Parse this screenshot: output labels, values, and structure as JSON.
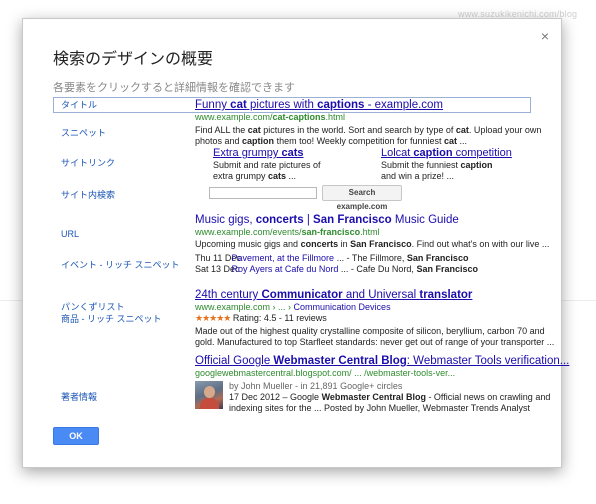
{
  "background": {
    "url": "www.suzukikenichi.com/blog"
  },
  "dialog": {
    "title": "検索のデザインの概要",
    "subtitle": "各要素をクリックすると詳細情報を確認できます",
    "close_label": "×",
    "ok_label": "OK"
  },
  "labels": [
    "タイトル",
    "スニペット",
    "サイトリンク",
    "サイト内検索",
    "URL",
    "イベント - リッチ スニペット",
    "パンくずリスト",
    "商品 - リッチ スニペット",
    "著者情報"
  ],
  "result1": {
    "title_a": "Funny ",
    "title_b": "cat",
    "title_c": " pictures with ",
    "title_d": "captions",
    "title_e": " - example.com",
    "url_a": "www.example.com/",
    "url_b": "cat-captions",
    "url_c": ".html",
    "snip": [
      "Find ALL the ",
      "cat",
      " pictures in the world. Sort and search by type of ",
      "cat",
      ". Upload your own",
      "photos and ",
      "caption",
      " them too! Weekly competition for funniest ",
      "cat",
      " ..."
    ]
  },
  "sitelinks": [
    {
      "t1": "Extra grumpy ",
      "t2": "cats",
      "d1": "Submit and rate pictures of",
      "d2a": "extra grumpy ",
      "d2b": "cats",
      "d2c": " ..."
    },
    {
      "t1": "Lolcat ",
      "t2": "caption",
      "t3": " competition",
      "d1a": "Submit the funniest ",
      "d1b": "caption",
      "d2": "and win a prize! ..."
    }
  ],
  "search": {
    "button_label": "Search example.com"
  },
  "result2": {
    "title_a": "Music gigs, ",
    "title_b": "concerts",
    "title_c": " | ",
    "title_d": "San Francisco",
    "title_e": " Music Guide",
    "url_a": "www.example.com/events/",
    "url_b": "san-francisco",
    "url_c": ".html",
    "snip_a": "Upcoming music gigs and ",
    "snip_b": "concerts",
    "snip_c": " in ",
    "snip_d": "San Francisco",
    "snip_e": ". Find out what's on with our live ...",
    "events": [
      {
        "date": "Thu 11 Dec",
        "link": "Pavement, at the Fillmore",
        "rest_a": " ... - The Fillmore, ",
        "rest_b": "San Francisco"
      },
      {
        "date": "Sat 13 Dec",
        "link": "Roy Ayers at Cafe du Nord",
        "rest_a": " ... - Cafe Du Nord, ",
        "rest_b": "San Francisco"
      }
    ]
  },
  "result3": {
    "title_a": "24th century ",
    "title_b": "Communicator",
    "title_c": " and Universal ",
    "title_d": "translator",
    "crumb_a": "www.example.com › ... › ",
    "crumb_link": "Communication Devices",
    "stars": "★★★★★",
    "rating_text": " Rating: 4.5 - 11 reviews",
    "snip_line1": "Made out of the highest quality crystalline composite of silicon, beryllium, carbon 70 and",
    "snip_line2": "gold. Manufactured to top Starfleet standards: never get out of range of your transporter ..."
  },
  "result4": {
    "title_a": "Official Google ",
    "title_b": "Webmaster Central Blog",
    "title_c": ": Webmaster Tools verification...",
    "url": "googlewebmastercentral.blogspot.com/ ... /webmaster-tools-ver...",
    "byline": "by John Mueller - in 21,891 Google+ circles",
    "snip1_a": "17 Dec 2012 – Google ",
    "snip1_b": "Webmaster Central Blog",
    "snip1_c": " - Official news on crawling and",
    "snip2": "indexing  sites for the ... Posted by John Mueller, Webmaster Trends Analyst"
  }
}
